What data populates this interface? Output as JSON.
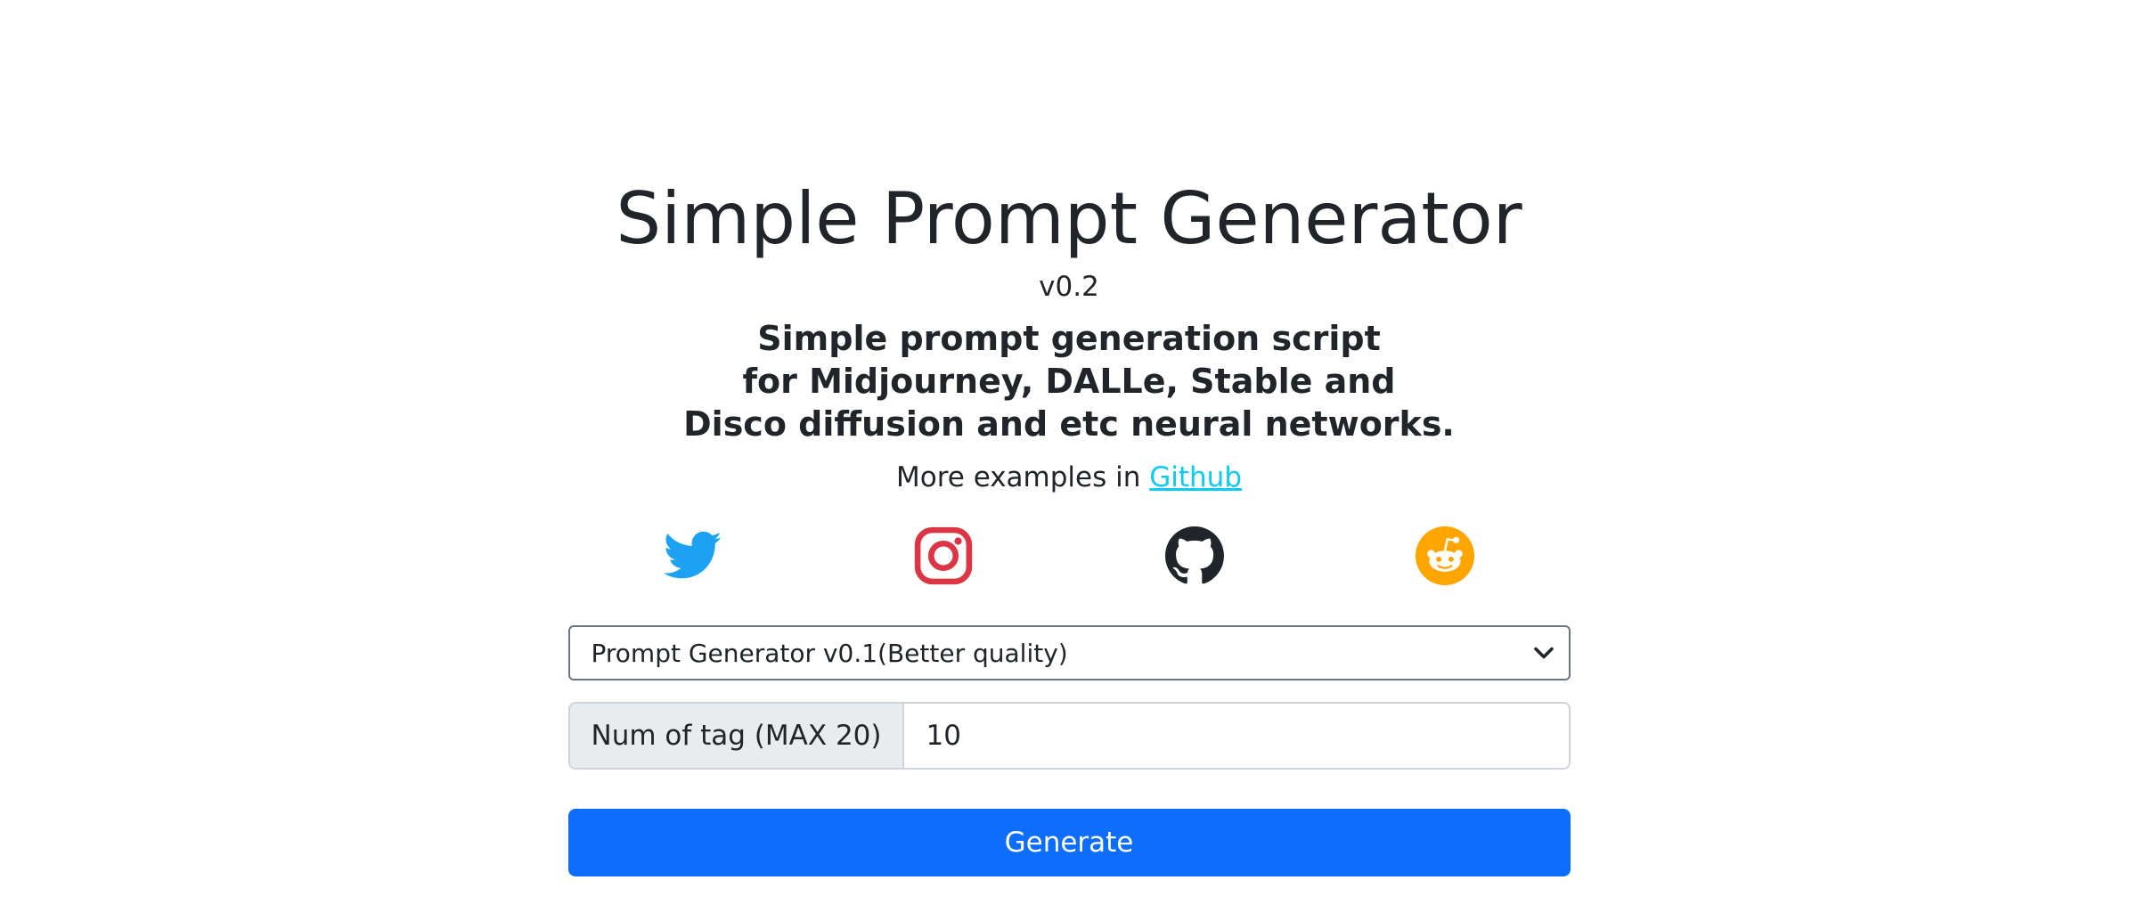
{
  "header": {
    "title": "Simple Prompt Generator",
    "version": "v0.2",
    "subtitle_lines": [
      "Simple prompt generation script",
      "for Midjourney, DALLe, Stable and",
      "Disco diffusion and etc neural networks."
    ],
    "more_prefix": "More examples in ",
    "more_link": "Github"
  },
  "social": {
    "icons": [
      "twitter-icon",
      "instagram-icon",
      "github-icon",
      "reddit-icon"
    ],
    "colors": {
      "twitter": "#1DA1F2",
      "instagram": "#DC3545",
      "github": "#212529",
      "reddit": "#FFA500"
    }
  },
  "form": {
    "generator_select": {
      "selected": "Prompt Generator v0.1(Better quality)"
    },
    "num_tags": {
      "label": "Num of tag (MAX 20)",
      "value": "10"
    },
    "generate_label": "Generate"
  },
  "colors": {
    "primary": "#0d6efd",
    "link": "#0dcaf0",
    "text": "#212529",
    "addon_bg": "#e9ecef"
  }
}
